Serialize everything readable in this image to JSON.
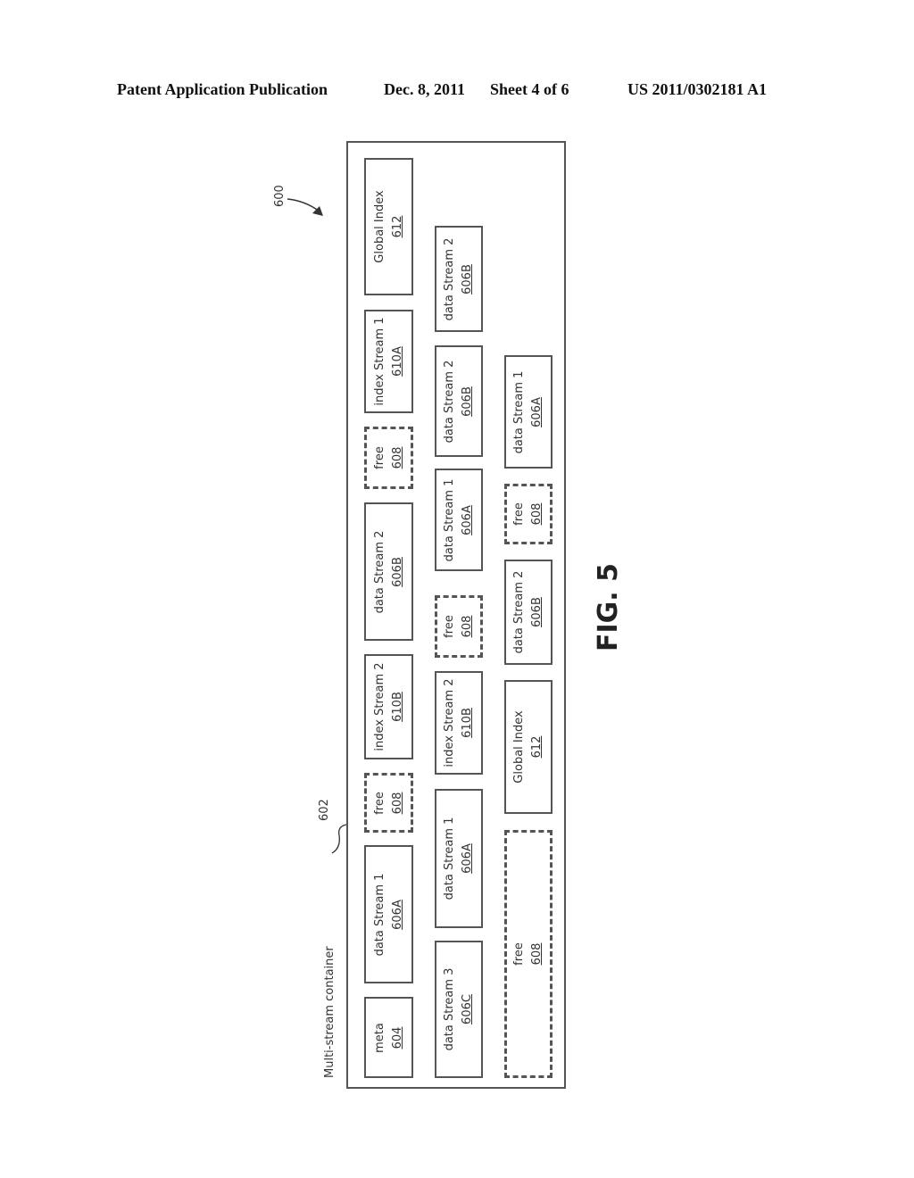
{
  "header": {
    "publication": "Patent Application Publication",
    "date": "Dec. 8, 2011",
    "sheet": "Sheet 4 of 6",
    "number": "US 2011/0302181 A1"
  },
  "diagram": {
    "ref_600": "600",
    "ref_602": "602",
    "container_title": "Multi-stream container",
    "figure_label": "FIG. 5",
    "rows": [
      [
        {
          "label": "meta",
          "ref": "604",
          "style": "solid"
        },
        {
          "label": "data Stream 1",
          "ref": "606A",
          "style": "solid"
        },
        {
          "label": "free",
          "ref": "608",
          "style": "dashed"
        },
        {
          "label": "index Stream 2",
          "ref": "610B",
          "style": "solid"
        },
        {
          "label": "data Stream 2",
          "ref": "606B",
          "style": "solid"
        },
        {
          "label": "free",
          "ref": "608",
          "style": "dashed"
        },
        {
          "label": "index Stream 1",
          "ref": "610A",
          "style": "solid"
        },
        {
          "label": "Global Index",
          "ref": "612",
          "style": "solid"
        }
      ],
      [
        {
          "label": "data Stream 3",
          "ref": "606C",
          "style": "solid"
        },
        {
          "label": "data Stream 1",
          "ref": "606A",
          "style": "solid"
        },
        {
          "label": "index Stream 2",
          "ref": "610B",
          "style": "solid"
        },
        {
          "label": "free",
          "ref": "608",
          "style": "dashed"
        },
        {
          "label": "data Stream 1",
          "ref": "606A",
          "style": "solid"
        },
        {
          "label": "data Stream 2",
          "ref": "606B",
          "style": "solid"
        },
        {
          "label": "data Stream 2",
          "ref": "606B",
          "style": "solid"
        }
      ],
      [
        {
          "label": "free",
          "ref": "608",
          "style": "dashed"
        },
        {
          "label": "Global Index",
          "ref": "612",
          "style": "solid"
        },
        {
          "label": "data Stream 2",
          "ref": "606B",
          "style": "solid"
        },
        {
          "label": "free",
          "ref": "608",
          "style": "dashed"
        },
        {
          "label": "data Stream 1",
          "ref": "606A",
          "style": "solid"
        }
      ]
    ]
  }
}
